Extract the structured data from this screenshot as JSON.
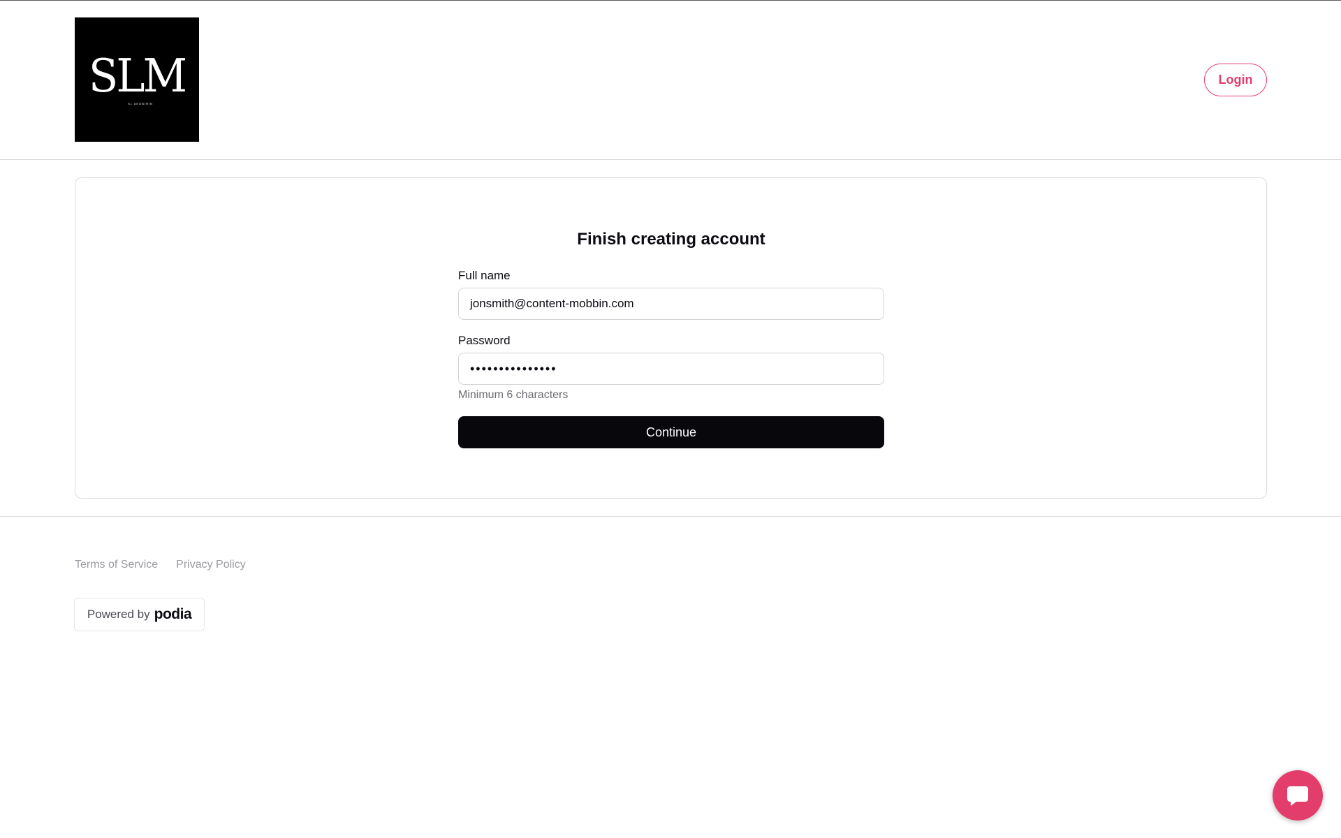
{
  "header": {
    "logo_text": "SLM",
    "logo_subtext": "SL AKOBIRIN",
    "login_label": "Login"
  },
  "form": {
    "title": "Finish creating account",
    "full_name_label": "Full name",
    "full_name_value": "jonsmith@content-mobbin.com",
    "password_label": "Password",
    "password_value": "•••••••••••••••",
    "password_hint": "Minimum 6 characters",
    "continue_label": "Continue"
  },
  "footer": {
    "terms_label": "Terms of Service",
    "privacy_label": "Privacy Policy",
    "powered_by_label": "Powered by",
    "powered_by_brand": "podia"
  },
  "colors": {
    "accent": "#e33e6b",
    "button_dark": "#07070c",
    "border": "#dcdcdf"
  },
  "icons": {
    "chat": "chat-bubble-icon"
  }
}
